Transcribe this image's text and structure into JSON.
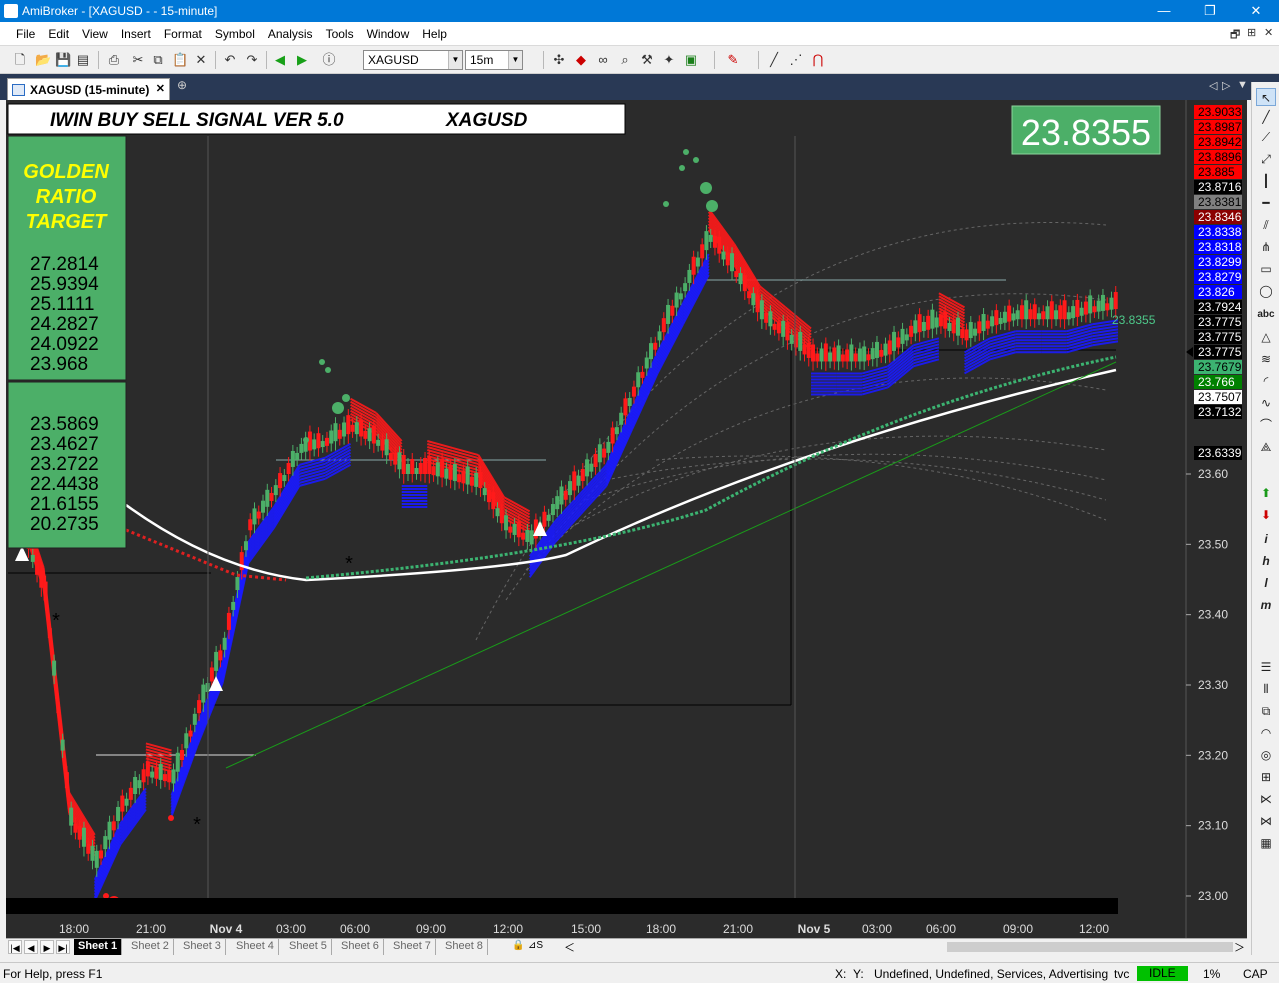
{
  "window": {
    "title": "AmiBroker - [XAGUSD -  - 15-minute]"
  },
  "menu": [
    "File",
    "Edit",
    "View",
    "Insert",
    "Format",
    "Symbol",
    "Analysis",
    "Tools",
    "Window",
    "Help"
  ],
  "toolbar": {
    "symbol": "XAGUSD",
    "interval": "15m"
  },
  "tab": {
    "label": "XAGUSD (15-minute)"
  },
  "chart": {
    "header_title": "IWIN BUY SELL SIGNAL VER 5.0",
    "header_symbol": "XAGUSD",
    "last_price": "23.8355",
    "last_price_tag": "23.8355",
    "golden_title": [
      "GOLDEN",
      "RATIO",
      "TARGET"
    ],
    "targets_upper": [
      "27.2814",
      "25.9394",
      "25.1111",
      "24.2827",
      "24.0922",
      "23.968"
    ],
    "targets_lower": [
      "23.5869",
      "23.4627",
      "23.2722",
      "22.4438",
      "21.6155",
      "20.2735"
    ],
    "colors": {
      "bg": "#2b2b2b",
      "bull": "#4caf68",
      "bear": "#ff1a1a",
      "blue": "#1a1aff",
      "green_panel": "#4caf68",
      "target_text": "#ffff00"
    },
    "price_labels": [
      {
        "text": "23.9033",
        "bg": "#ff0000",
        "fg": "#000000"
      },
      {
        "text": "23.8987",
        "bg": "#ff0000",
        "fg": "#000000"
      },
      {
        "text": "23.8942",
        "bg": "#ff0000",
        "fg": "#000000"
      },
      {
        "text": "23.8896",
        "bg": "#ff0000",
        "fg": "#000000"
      },
      {
        "text": "23.885",
        "bg": "#ff0000",
        "fg": "#000000"
      },
      {
        "text": "23.8716",
        "bg": "#000000",
        "fg": "#ffffff"
      },
      {
        "text": "23.8381",
        "bg": "#808080",
        "fg": "#000000"
      },
      {
        "text": "23.8346",
        "bg": "#8b0000",
        "fg": "#ffffff"
      },
      {
        "text": "23.8338",
        "bg": "#0000ff",
        "fg": "#ffffff"
      },
      {
        "text": "23.8318",
        "bg": "#0000ff",
        "fg": "#ffffff"
      },
      {
        "text": "23.8299",
        "bg": "#0000ff",
        "fg": "#ffffff"
      },
      {
        "text": "23.8279",
        "bg": "#0000ff",
        "fg": "#ffffff"
      },
      {
        "text": "23.826",
        "bg": "#0000ff",
        "fg": "#ffffff"
      },
      {
        "text": "23.7924",
        "bg": "#000000",
        "fg": "#ffffff"
      },
      {
        "text": "23.7775",
        "bg": "#000000",
        "fg": "#ffffff"
      },
      {
        "text": "23.7775",
        "bg": "#000000",
        "fg": "#ffffff"
      },
      {
        "text": "23.7775",
        "bg": "#000000",
        "fg": "#ffffff"
      },
      {
        "text": "23.7679",
        "bg": "#3cb371",
        "fg": "#000000"
      },
      {
        "text": "23.766",
        "bg": "#008000",
        "fg": "#ffffff"
      },
      {
        "text": "23.7507",
        "bg": "#ffffff",
        "fg": "#000000"
      },
      {
        "text": "23.7132",
        "bg": "#000000",
        "fg": "#ffffff"
      },
      {
        "text": "23.6339",
        "bg": "#000000",
        "fg": "#ffffff"
      }
    ],
    "y_ticks": [
      "23.60",
      "23.50",
      "23.40",
      "23.30",
      "23.20",
      "23.10",
      "23.00"
    ],
    "x_ticks": [
      "18:00",
      "21:00",
      "Nov 4",
      "03:00",
      "06:00",
      "09:00",
      "12:00",
      "15:00",
      "18:00",
      "21:00",
      "Nov 5",
      "03:00",
      "06:00",
      "09:00",
      "12:00"
    ]
  },
  "chart_data": {
    "type": "candlestick",
    "title": "IWIN BUY SELL SIGNAL VER 5.0",
    "symbol": "XAGUSD",
    "interval": "15-minute",
    "ylim": [
      22.96,
      23.96
    ],
    "grid": false,
    "y_ticks": [
      23.6,
      23.5,
      23.4,
      23.3,
      23.2,
      23.1,
      23.0
    ],
    "x_categories": [
      "18:00",
      "21:00",
      "Nov 4",
      "03:00",
      "06:00",
      "09:00",
      "12:00",
      "15:00",
      "18:00",
      "21:00",
      "Nov 5",
      "03:00",
      "06:00",
      "09:00",
      "12:00"
    ],
    "close_path": [
      {
        "t": "17:00",
        "close": 23.53
      },
      {
        "t": "18:00",
        "close": 23.42
      },
      {
        "t": "19:00",
        "close": 23.1
      },
      {
        "t": "19:45",
        "close": 23.04
      },
      {
        "t": "20:30",
        "close": 23.12
      },
      {
        "t": "21:00",
        "close": 23.17
      },
      {
        "t": "22:00",
        "close": 23.16
      },
      {
        "t": "23:00",
        "close": 23.26
      },
      {
        "t": "00:00",
        "close": 23.35
      },
      {
        "t": "01:00",
        "close": 23.52
      },
      {
        "t": "02:00",
        "close": 23.57
      },
      {
        "t": "03:00",
        "close": 23.63
      },
      {
        "t": "04:00",
        "close": 23.64
      },
      {
        "t": "05:00",
        "close": 23.66
      },
      {
        "t": "06:00",
        "close": 23.64
      },
      {
        "t": "07:00",
        "close": 23.6
      },
      {
        "t": "08:00",
        "close": 23.6
      },
      {
        "t": "09:00",
        "close": 23.59
      },
      {
        "t": "10:00",
        "close": 23.58
      },
      {
        "t": "11:00",
        "close": 23.52
      },
      {
        "t": "12:00",
        "close": 23.5
      },
      {
        "t": "13:00",
        "close": 23.55
      },
      {
        "t": "14:00",
        "close": 23.59
      },
      {
        "t": "15:00",
        "close": 23.63
      },
      {
        "t": "16:00",
        "close": 23.71
      },
      {
        "t": "17:00",
        "close": 23.79
      },
      {
        "t": "18:00",
        "close": 23.86
      },
      {
        "t": "19:00",
        "close": 23.93
      },
      {
        "t": "20:00",
        "close": 23.88
      },
      {
        "t": "21:00",
        "close": 23.82
      },
      {
        "t": "22:00",
        "close": 23.79
      },
      {
        "t": "23:00",
        "close": 23.76
      },
      {
        "t": "Nov 5",
        "close": 23.76
      },
      {
        "t": "02:00",
        "close": 23.76
      },
      {
        "t": "04:00",
        "close": 23.77
      },
      {
        "t": "05:00",
        "close": 23.8
      },
      {
        "t": "06:00",
        "close": 23.81
      },
      {
        "t": "07:00",
        "close": 23.79
      },
      {
        "t": "08:00",
        "close": 23.81
      },
      {
        "t": "09:00",
        "close": 23.82
      },
      {
        "t": "10:00",
        "close": 23.82
      },
      {
        "t": "11:00",
        "close": 23.82
      },
      {
        "t": "12:00",
        "close": 23.83
      },
      {
        "t": "13:00",
        "close": 23.8355
      }
    ],
    "last_close": 23.8355
  },
  "sheets": [
    "Sheet 1",
    "Sheet 2",
    "Sheet 3",
    "Sheet 4",
    "Sheet 5",
    "Sheet 6",
    "Sheet 7",
    "Sheet 8"
  ],
  "status": {
    "help": "For Help, press F1",
    "x": "X:",
    "y": "Y:",
    "info": "Undefined, Undefined, Services, Advertising",
    "tvc": "tvc",
    "state": "IDLE",
    "pct": "1%",
    "cap": "CAP"
  }
}
